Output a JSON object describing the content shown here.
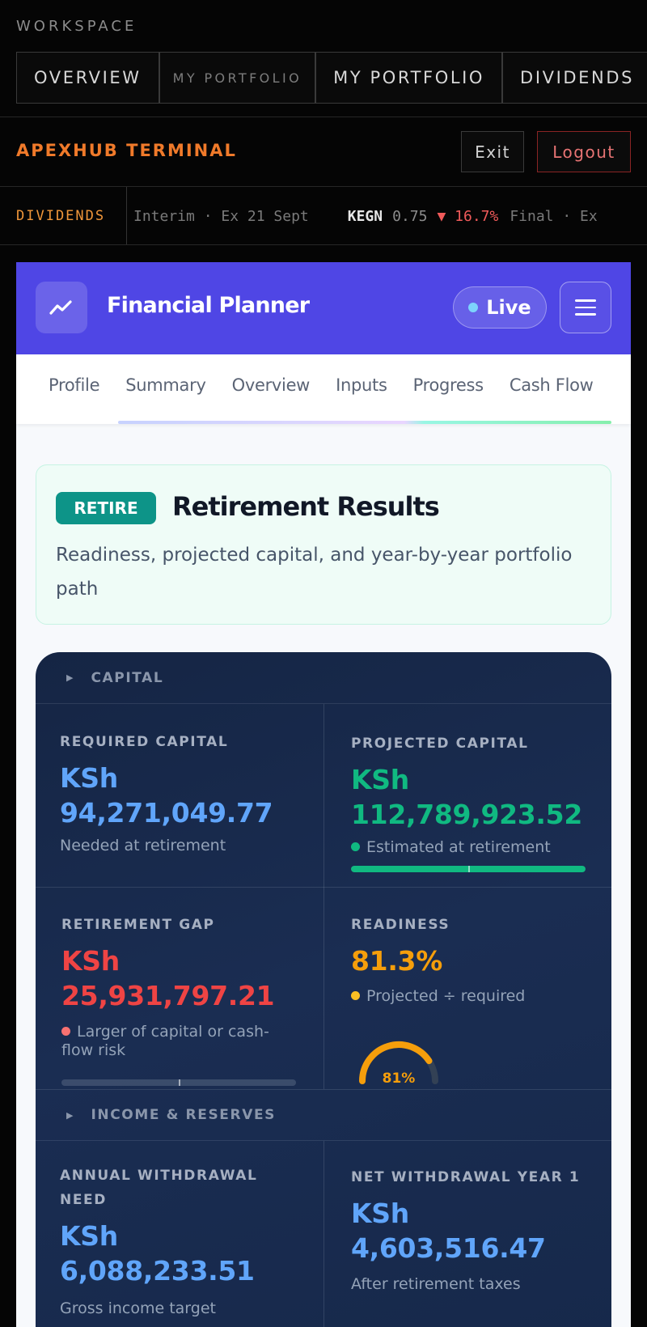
{
  "workspace": {
    "label": "WORKSPACE",
    "tabs": [
      "OVERVIEW",
      "MY PORTFOLIO",
      "MY PORTFOLIO",
      "DIVIDENDS"
    ]
  },
  "brand": {
    "title": "APEXHUB TERMINAL",
    "exit_label": "Exit",
    "logout_label": "Logout"
  },
  "ticker": {
    "label": "DIVIDENDS",
    "lead_note": "Interim · Ex 21 Sept",
    "symbol": "KEGN",
    "price": "0.75",
    "change": "▼ 16.7%",
    "tail_note": "Final · Ex"
  },
  "app": {
    "title": "Financial Planner",
    "live_label": "Live",
    "logo_icon": "trend-up-icon",
    "tabs": [
      "Profile",
      "Summary",
      "Overview",
      "Inputs",
      "Progress",
      "Cash Flow"
    ]
  },
  "intro": {
    "badge": "RETIRE",
    "title": "Retirement Results",
    "subtitle": "Readiness, projected capital, and year-by-year portfolio path"
  },
  "capital": {
    "section_label": "CAPITAL",
    "required": {
      "label": "REQUIRED CAPITAL",
      "currency": "KSh",
      "value": "94,271,049.77",
      "note": "Needed at retirement"
    },
    "projected": {
      "label": "PROJECTED CAPITAL",
      "currency": "KSh",
      "value": "112,789,923.52",
      "note": "Estimated at retirement",
      "bar_fraction": 1.0
    },
    "gap": {
      "label": "RETIREMENT GAP",
      "currency": "KSh",
      "value": "25,931,797.21",
      "note": "Larger of capital or cash-flow risk",
      "bar_fraction": 0.0
    },
    "readiness": {
      "label": "READINESS",
      "value": "81.3%",
      "note": "Projected ÷ required",
      "gauge_label": "81%",
      "gauge_fraction": 0.813
    }
  },
  "income": {
    "section_label": "INCOME & RESERVES",
    "annual_need": {
      "label_line1": "ANNUAL WITHDRAWAL",
      "label_line2": "NEED",
      "currency": "KSh",
      "value": "6,088,233.51",
      "note": "Gross income target"
    },
    "net_year1": {
      "label": "NET WITHDRAWAL YEAR 1",
      "currency": "KSh",
      "value": "4,603,516.47",
      "note": "After retirement taxes"
    }
  },
  "colors": {
    "accent_orange": "#f07a2a",
    "header_indigo": "#4f46e5",
    "badge_teal": "#0d9488",
    "value_blue": "#60a5fa",
    "value_green": "#10b981",
    "value_red": "#ef4444",
    "value_amber": "#f59e0b"
  }
}
